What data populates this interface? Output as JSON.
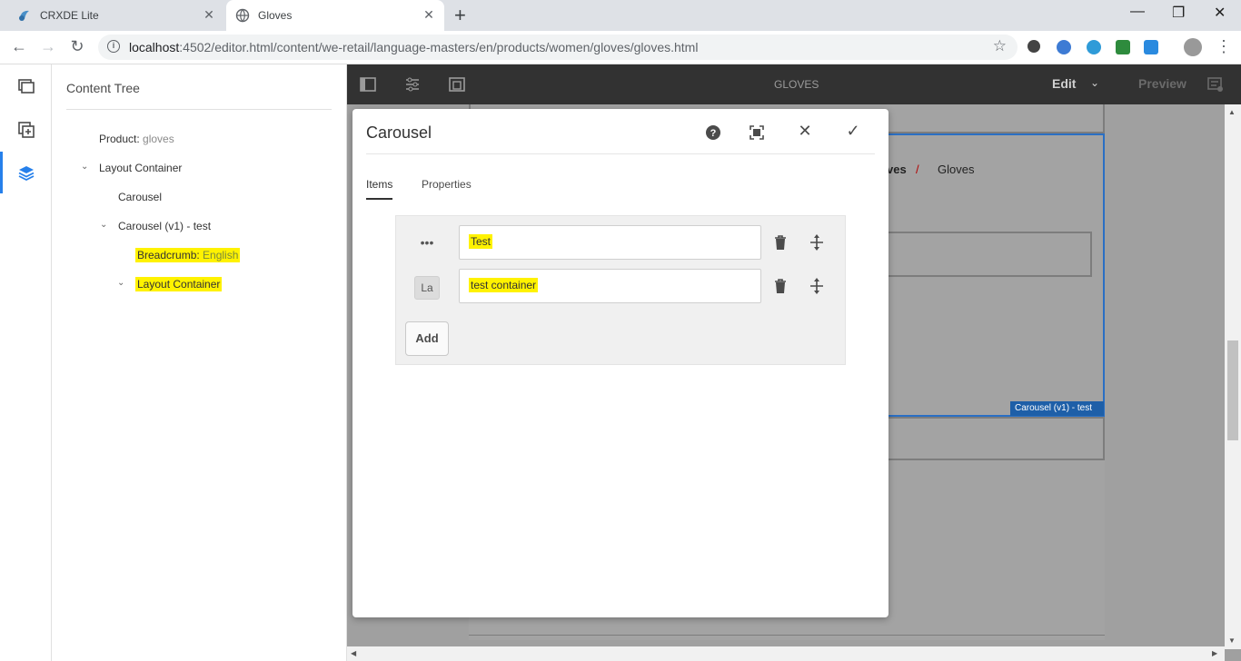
{
  "browser": {
    "tabs": [
      {
        "title": "CRXDE Lite",
        "icon": "crxde-icon",
        "active": false
      },
      {
        "title": "Gloves",
        "icon": "globe-icon",
        "active": true
      }
    ],
    "url_host": "localhost",
    "url_path": ":4502/editor.html/content/we-retail/language-masters/en/products/women/gloves/gloves.html",
    "new_tab": "+",
    "close": "✕",
    "minimize": "—",
    "maximize": "❐",
    "window_close": "✕",
    "star": "☆"
  },
  "side_panel": {
    "title": "Content Tree",
    "tree": [
      {
        "label": "Product: ",
        "sub": "gloves"
      },
      {
        "label": "Layout Container"
      },
      {
        "label": "Carousel"
      },
      {
        "label": "Carousel (v1) - test"
      },
      {
        "label": "Breadcrumb: ",
        "sub": "English"
      },
      {
        "label": "Layout Container"
      }
    ]
  },
  "editor": {
    "page_name": "GLOVES",
    "mode": "Edit",
    "preview": "Preview",
    "bg_breadcrumb_part": "ves",
    "bg_breadcrumb_sep": "/",
    "bg_breadcrumb_current": "Gloves",
    "component_tag": "Carousel (v1) - test"
  },
  "dialog": {
    "title": "Carousel",
    "help": "?",
    "fullscreen": "⛶",
    "close": "✕",
    "done": "✓",
    "tabs": [
      "Items",
      "Properties"
    ],
    "items": [
      {
        "handle": "•••",
        "value": "Test"
      },
      {
        "handle": "La",
        "value": "test container"
      }
    ],
    "add_label": "Add"
  },
  "colors": {
    "accent": "#2680eb",
    "highlight": "#fff200",
    "toolbar": "#323232",
    "component_tag": "#1e5fa8"
  }
}
